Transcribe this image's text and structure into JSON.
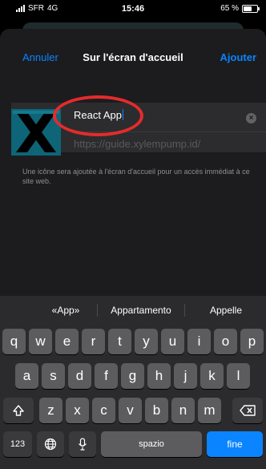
{
  "status_bar": {
    "carrier": "SFR",
    "network": "4G",
    "time": "15:46",
    "battery": "65 %",
    "battery_level": 0.65
  },
  "nav": {
    "cancel_label": "Annuler",
    "title": "Sur l'écran d'accueil",
    "add_label": "Ajouter"
  },
  "bookmark": {
    "name_value": "React App",
    "url": "https://guide.xylempump.id/",
    "description": "Une icône sera ajoutée à l'écran d'accueil pour un accès immédiat à ce site web."
  },
  "keyboard": {
    "suggestions": [
      "«App»",
      "Appartamento",
      "Appelle"
    ],
    "row1": [
      "q",
      "w",
      "e",
      "r",
      "t",
      "y",
      "u",
      "i",
      "o",
      "p"
    ],
    "row2": [
      "a",
      "s",
      "d",
      "f",
      "g",
      "h",
      "j",
      "k",
      "l"
    ],
    "row3": [
      "z",
      "x",
      "c",
      "v",
      "b",
      "n",
      "m"
    ],
    "numbers_label": "123",
    "space_label": "spazio",
    "return_label": "fine"
  },
  "colors": {
    "accent": "#0a84ff",
    "sheet": "#1c1c1e",
    "annotation": "#e52b2b"
  }
}
